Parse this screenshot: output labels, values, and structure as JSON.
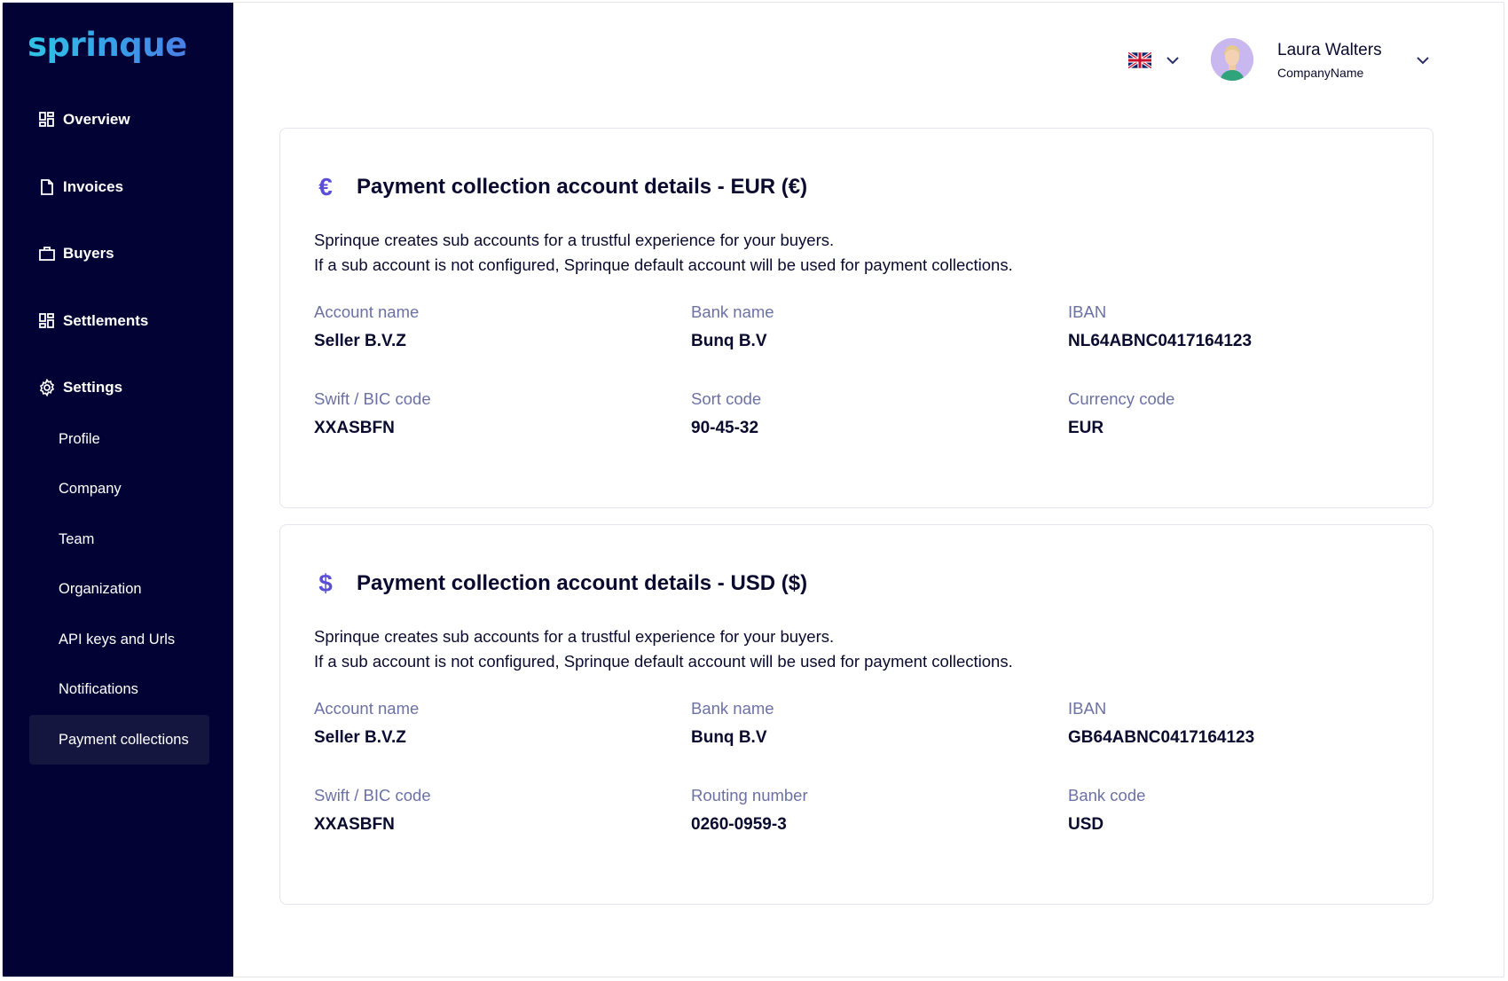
{
  "app": {
    "logo": "sprinque"
  },
  "sidebar": {
    "nav": [
      {
        "label": "Overview",
        "icon": "dashboard-icon"
      },
      {
        "label": "Invoices",
        "icon": "document-icon"
      },
      {
        "label": "Buyers",
        "icon": "briefcase-icon"
      },
      {
        "label": "Settlements",
        "icon": "dashboard-icon"
      },
      {
        "label": "Settings",
        "icon": "gear-icon"
      }
    ],
    "settings_items": [
      {
        "label": "Profile"
      },
      {
        "label": "Company"
      },
      {
        "label": "Team"
      },
      {
        "label": "Organization"
      },
      {
        "label": "API keys and Urls"
      },
      {
        "label": "Notifications"
      },
      {
        "label": "Payment collections",
        "active": true
      }
    ]
  },
  "header": {
    "language_icon": "uk-flag-icon",
    "user": {
      "name": "Laura Walters",
      "company": "CompanyName"
    }
  },
  "cards": [
    {
      "icon": "euro-icon",
      "symbol": "€",
      "title": "Payment collection account details - EUR (€)",
      "description_line1": "Sprinque creates sub accounts for a trustful experience for your buyers.",
      "description_line2": "If a sub account is not configured, Sprinque default account will be used for payment collections.",
      "fields": [
        {
          "label": "Account name",
          "value": "Seller B.V.Z"
        },
        {
          "label": "Bank name",
          "value": "Bunq B.V"
        },
        {
          "label": "IBAN",
          "value": "NL64ABNC0417164123"
        },
        {
          "label": "Swift / BIC code",
          "value": "XXASBFN"
        },
        {
          "label": "Sort code",
          "value": "90-45-32"
        },
        {
          "label": "Currency code",
          "value": "EUR"
        }
      ]
    },
    {
      "icon": "dollar-icon",
      "symbol": "$",
      "title": "Payment collection account details - USD ($)",
      "description_line1": "Sprinque creates sub accounts for a trustful experience for your buyers.",
      "description_line2": "If a sub account is not configured, Sprinque default account will be used for payment collections.",
      "fields": [
        {
          "label": "Account name",
          "value": "Seller B.V.Z"
        },
        {
          "label": "Bank name",
          "value": "Bunq B.V"
        },
        {
          "label": "IBAN",
          "value": "GB64ABNC0417164123"
        },
        {
          "label": "Swift / BIC code",
          "value": "XXASBFN"
        },
        {
          "label": "Routing number",
          "value": "0260-0959-3"
        },
        {
          "label": "Bank code",
          "value": "USD"
        }
      ]
    }
  ],
  "colors": {
    "sidebar_bg": "#020334",
    "accent": "#5a4fd6",
    "label": "#6c71a4",
    "text": "#0a0b2e"
  }
}
